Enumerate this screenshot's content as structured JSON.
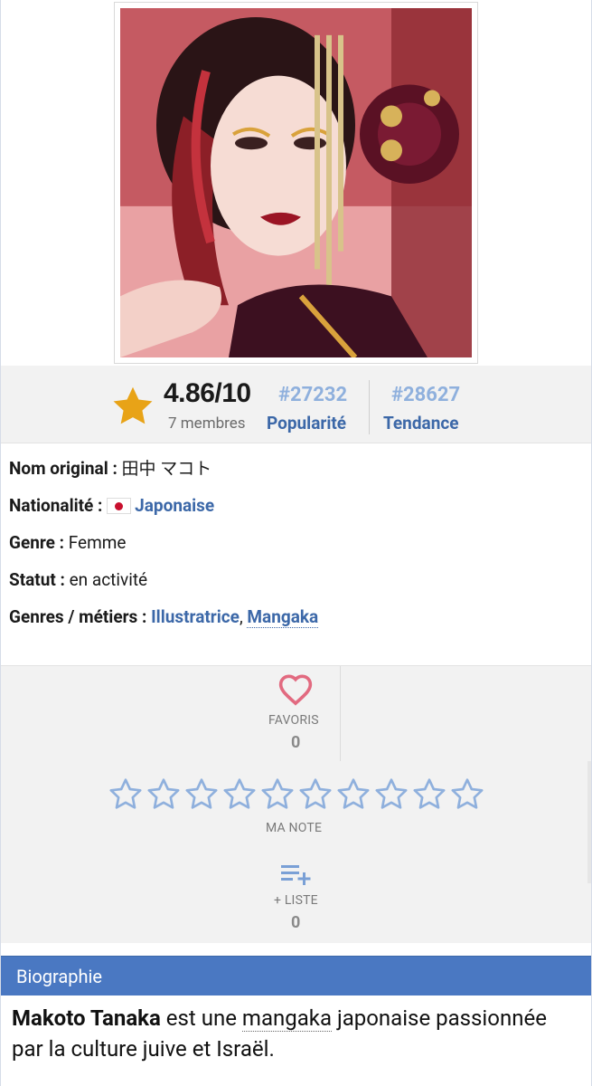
{
  "photo": {
    "alt": "portrait"
  },
  "rating": {
    "score": "4.86/10",
    "members": "7 membres",
    "popularity_rank": "#27232",
    "popularity_label": "Popularité",
    "trend_rank": "#28627",
    "trend_label": "Tendance"
  },
  "info": {
    "original_name_label": "Nom original :",
    "original_name_value": "田中 マコト",
    "nationality_label": "Nationalité :",
    "nationality_value": "Japonaise",
    "gender_label": "Genre :",
    "gender_value": "Femme",
    "status_label": "Statut :",
    "status_value": "en activité",
    "jobs_label": "Genres / métiers :",
    "jobs": [
      "Illustratrice",
      "Mangaka"
    ],
    "jobs_separator": ","
  },
  "actions": {
    "favorites_label": "FAVORIS",
    "favorites_count": "0",
    "my_rating_label": "MA NOTE",
    "my_rating_max": 10,
    "list_label": "+ LISTE",
    "list_count": "0"
  },
  "biography": {
    "heading": "Biographie",
    "name": "Makoto Tanaka",
    "text_a": " est une ",
    "link": "mangaka",
    "text_b": " japonaise passionnée par la culture juive et Israël."
  },
  "colors": {
    "accent_blue": "#3c68a8",
    "rank_blue": "#8fb0dd",
    "star_gold": "#e8a317",
    "heart_pink": "#e26a80",
    "bio_header": "#4a78c2"
  },
  "icons": {
    "rating": "star-icon",
    "favorite": "heart-icon",
    "add_list": "playlist-add-icon",
    "flag": "japan-flag-icon"
  }
}
